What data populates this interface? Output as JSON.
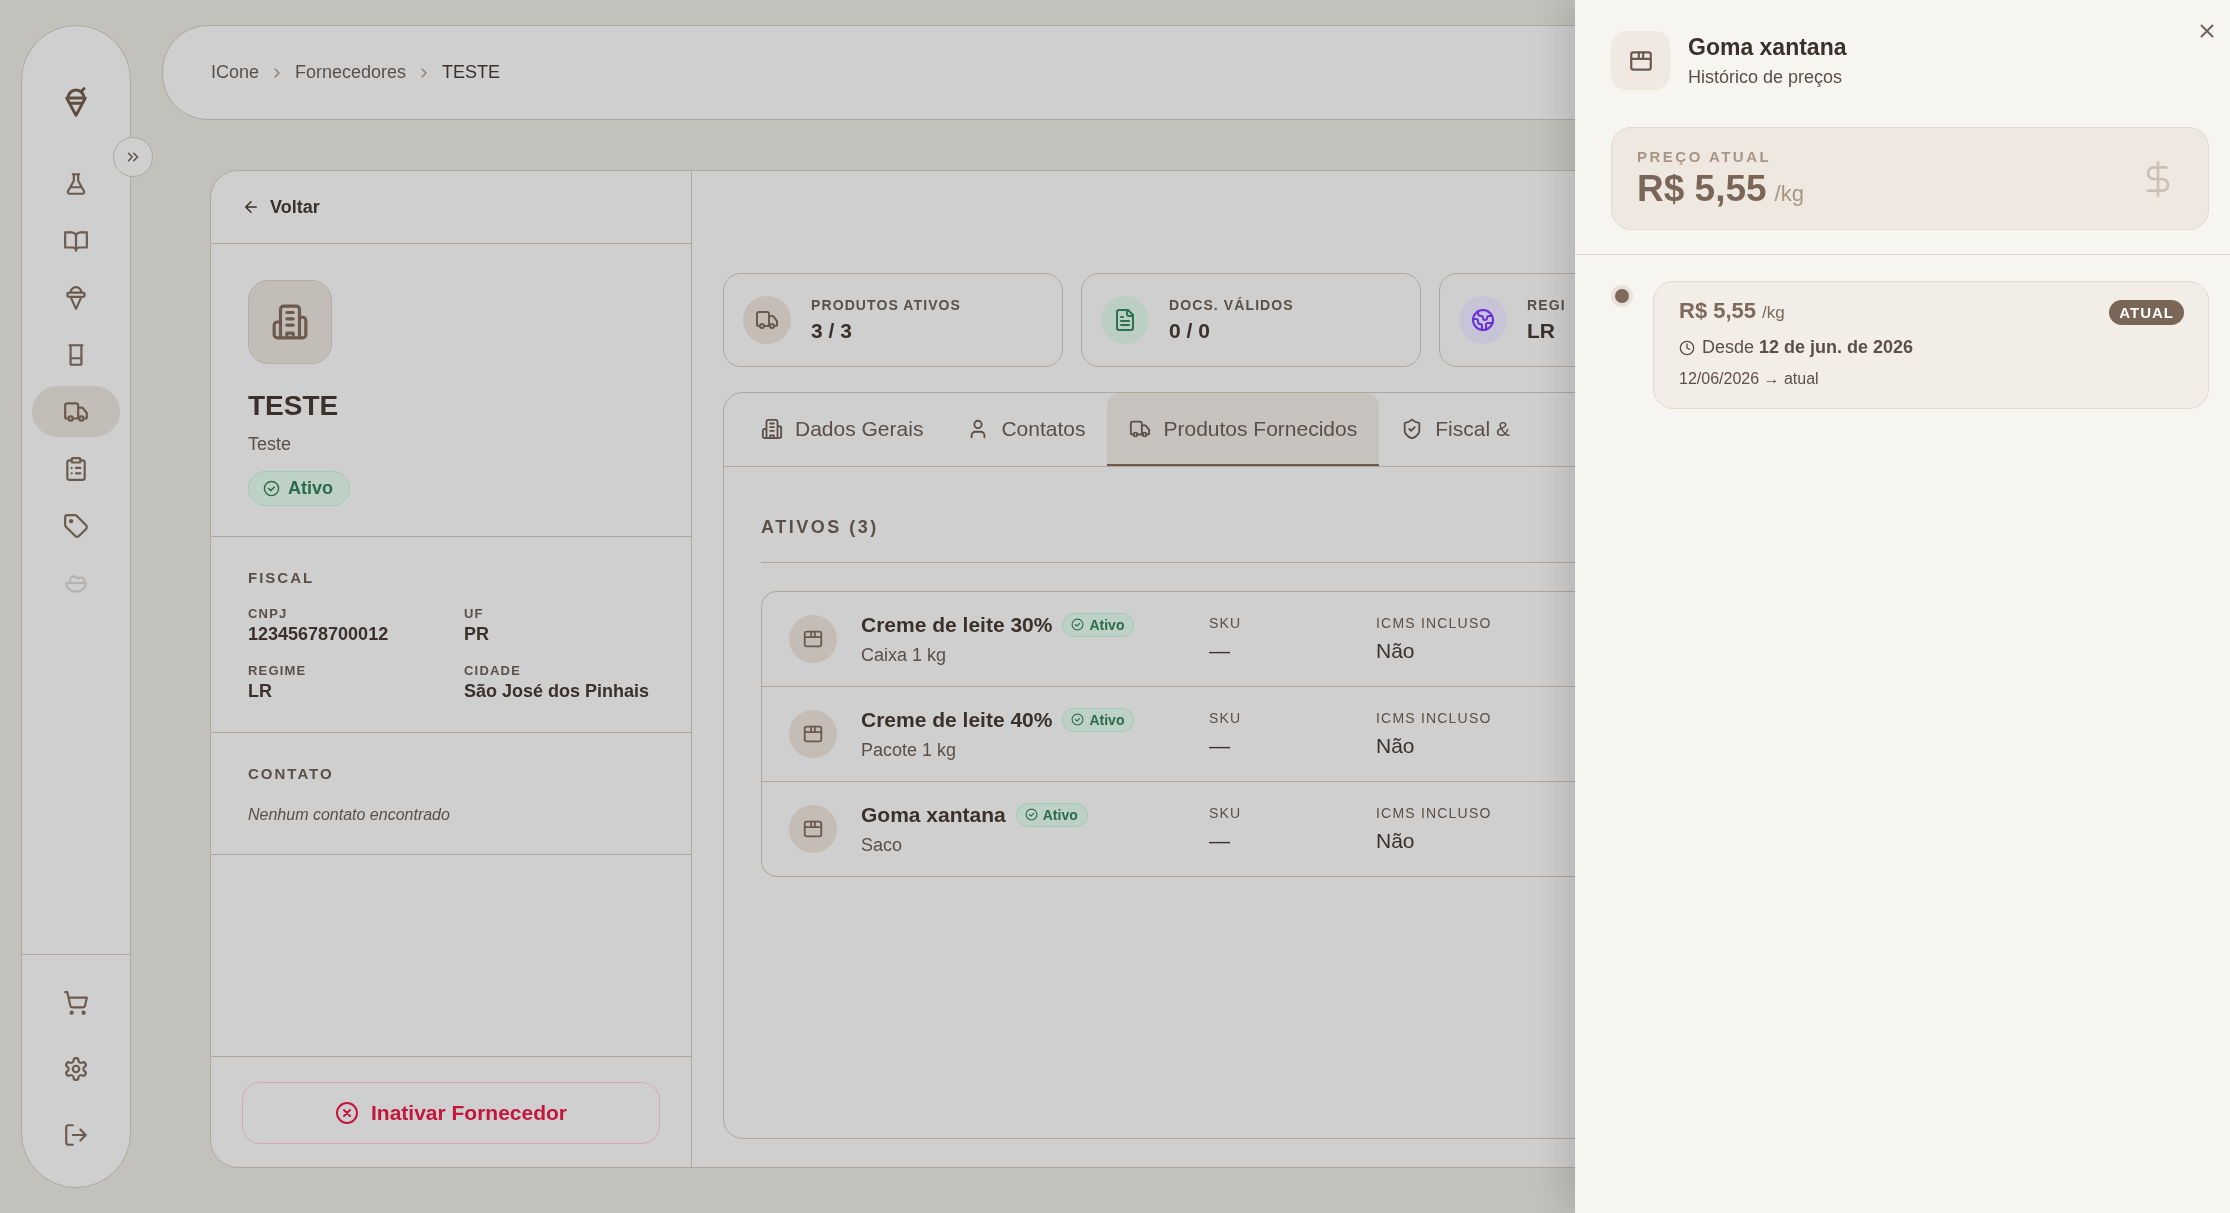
{
  "sidebar": {
    "items": [
      {
        "kind": "flask",
        "selected": false,
        "disabled": false
      },
      {
        "kind": "book",
        "selected": false,
        "disabled": false
      },
      {
        "kind": "icecream",
        "selected": false,
        "disabled": false
      },
      {
        "kind": "cup",
        "selected": false,
        "disabled": false
      },
      {
        "kind": "truck",
        "selected": true,
        "disabled": false
      },
      {
        "kind": "clipboard",
        "selected": false,
        "disabled": false
      },
      {
        "kind": "tag",
        "selected": false,
        "disabled": false
      },
      {
        "kind": "bowl",
        "selected": false,
        "disabled": true
      }
    ],
    "bottom_items": [
      {
        "kind": "cart"
      },
      {
        "kind": "settings"
      },
      {
        "kind": "logout"
      }
    ]
  },
  "breadcrumb": [
    "ICone",
    "Fornecedores",
    "TESTE"
  ],
  "back_link": "Voltar",
  "supplier": {
    "name": "TESTE",
    "subtitle": "Teste",
    "status": "Ativo"
  },
  "fiscal": {
    "heading": "FISCAL",
    "fields": [
      {
        "label": "CNPJ",
        "value": "12345678700012"
      },
      {
        "label": "UF",
        "value": "PR"
      },
      {
        "label": "REGIME",
        "value": "LR"
      },
      {
        "label": "CIDADE",
        "value": "São José dos Pinhais"
      }
    ]
  },
  "contact": {
    "heading": "CONTATO",
    "empty_text": "Nenhum contato encontrado"
  },
  "deactivate_button": "Inativar Fornecedor",
  "stats": [
    {
      "kind": "truck",
      "label": "PRODUTOS ATIVOS",
      "value": "3 / 3"
    },
    {
      "kind": "document",
      "label": "DOCS. VÁLIDOS",
      "value": "0 / 0"
    },
    {
      "kind": "globe",
      "label": "REGI",
      "value": "LR"
    }
  ],
  "tabs": [
    {
      "kind": "building",
      "label": "Dados Gerais",
      "selected": false
    },
    {
      "kind": "user",
      "label": "Contatos",
      "selected": false
    },
    {
      "kind": "truck",
      "label": "Produtos Fornecidos",
      "selected": true
    },
    {
      "kind": "shield",
      "label": "Fiscal &",
      "selected": false
    }
  ],
  "products_heading": "ATIVOS (3)",
  "products": [
    {
      "name": "Creme de leite 30%",
      "unit": "Caixa 1 kg",
      "status": "Ativo",
      "sku_label": "SKU",
      "sku": "—",
      "icms_label": "ICMS INCLUSO",
      "icms": "Não"
    },
    {
      "name": "Creme de leite 40%",
      "unit": "Pacote 1 kg",
      "status": "Ativo",
      "sku_label": "SKU",
      "sku": "—",
      "icms_label": "ICMS INCLUSO",
      "icms": "Não"
    },
    {
      "name": "Goma xantana",
      "unit": "Saco",
      "status": "Ativo",
      "sku_label": "SKU",
      "sku": "—",
      "icms_label": "ICMS INCLUSO",
      "icms": "Não"
    }
  ],
  "drawer": {
    "title": "Goma xantana",
    "subtitle": "Histórico de preços",
    "current_price": {
      "label": "PREÇO ATUAL",
      "value": "R$ 5,55",
      "unit": "/kg"
    },
    "history": [
      {
        "price": "R$ 5,55",
        "unit": "/kg",
        "badge": "ATUAL",
        "since": "Desde **12 de jun. de 2026**",
        "range": "12/06/2026 → atual"
      }
    ]
  }
}
